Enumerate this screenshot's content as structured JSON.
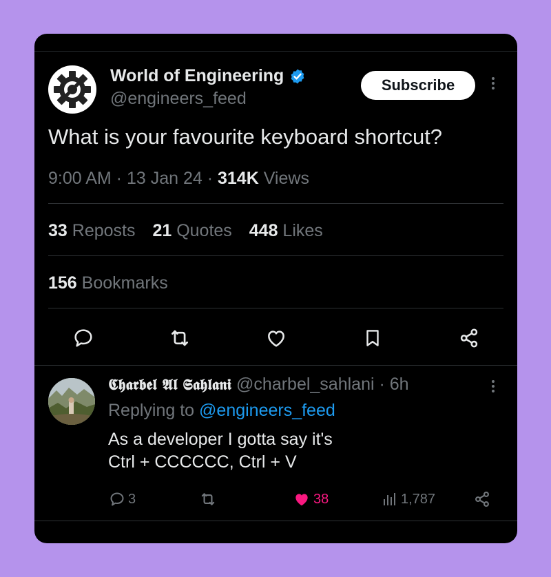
{
  "post": {
    "author_name": "World of Engineering",
    "author_handle": "@engineers_feed",
    "subscribe_label": "Subscribe",
    "text": "What is your favourite keyboard shortcut?",
    "time": "9:00 AM",
    "sep1": " · ",
    "date": "13 Jan 24",
    "sep2": " · ",
    "views_count": "314K",
    "views_label": " Views",
    "reposts_count": "33",
    "reposts_label": " Reposts",
    "quotes_count": "21",
    "quotes_label": " Quotes",
    "likes_count": "448",
    "likes_label": " Likes",
    "bookmarks_count": "156",
    "bookmarks_label": " Bookmarks",
    "actions": [
      "reply-icon",
      "repost-icon",
      "like-icon",
      "bookmark-icon",
      "share-icon"
    ]
  },
  "reply": {
    "author_name": "𝕮𝖍𝖆𝖗𝖇𝖊𝖑 𝕬𝖑 𝕾𝖆𝖍𝖑𝖆𝖓𝖎",
    "author_handle": "@charbel_sahlani",
    "time": " · 6h",
    "replying_prefix": "Replying to ",
    "replying_to": "@engineers_feed",
    "text_line1": "As a developer I gotta say it's",
    "text_line2": "Ctrl + CCCCCC, Ctrl + V",
    "reply_count": "3",
    "like_count": "38",
    "views_count": "1,787"
  },
  "colors": {
    "background": "#b593ec",
    "card": "#000000",
    "text": "#e7e9ea",
    "muted": "#71767b",
    "accent": "#1d9bf0",
    "like": "#f91880"
  }
}
